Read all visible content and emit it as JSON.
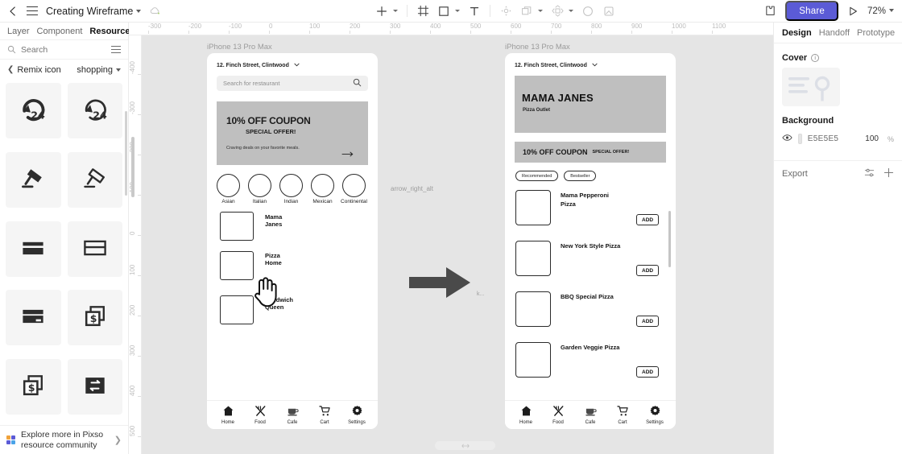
{
  "topbar": {
    "back_icon": "chevron-left-icon",
    "menu_icon": "hamburger-menu-icon",
    "title": "Creating Wireframe",
    "cloud_icon": "cloud-sync-icon",
    "tools": [
      {
        "name": "add-tool",
        "icon": "plus-icon",
        "caret": true
      },
      {
        "name": "frame-tool",
        "icon": "frame-icon",
        "caret": false
      },
      {
        "name": "shape-tool",
        "icon": "square-icon",
        "caret": true
      },
      {
        "name": "text-tool",
        "icon": "text-T-icon",
        "caret": false
      },
      {
        "name": "move-tool",
        "icon": "move-target-icon",
        "caret": false
      },
      {
        "name": "duplicate-tool",
        "icon": "copy-icon",
        "caret": true
      },
      {
        "name": "component-tool",
        "icon": "component-icon",
        "caret": true
      },
      {
        "name": "ellipse-tool",
        "icon": "circle-icon",
        "caret": false
      },
      {
        "name": "image-tool",
        "icon": "image-placeholder-icon",
        "caret": false
      }
    ],
    "plugin_icon": "plugin-puzzle-icon",
    "share_label": "Share",
    "present_icon": "play-triangle-icon",
    "zoom_level": "72%"
  },
  "left_panel": {
    "tabs": [
      {
        "label": "Layer",
        "active": false
      },
      {
        "label": "Component",
        "active": false
      },
      {
        "label": "Resource",
        "active": true
      }
    ],
    "search": {
      "icon": "search-icon",
      "placeholder": "Search",
      "list_icon": "list-view-icon"
    },
    "breadcrumb": {
      "back_icon": "chevron-left-icon",
      "label": "Remix icon",
      "category": "shopping",
      "category_caret": "chevron-down-icon"
    },
    "icons": [
      {
        "name": "time-24-hours-fill-icon"
      },
      {
        "name": "time-24-hours-line-icon"
      },
      {
        "name": "auction-fill-icon"
      },
      {
        "name": "auction-line-icon"
      },
      {
        "name": "bank-card-fill-icon"
      },
      {
        "name": "bank-card-line-icon"
      },
      {
        "name": "bank-card-2-fill-icon"
      },
      {
        "name": "money-dollar-box-fill-icon"
      },
      {
        "name": "money-dollar-box-line-icon"
      },
      {
        "name": "exchange-box-fill-icon"
      }
    ],
    "footer": {
      "icon": "pixso-grid-icon",
      "text": "Explore more in Pixso resource community",
      "arrow": "chevron-right-icon"
    }
  },
  "rulers": {
    "horizontal": [
      "-300",
      "-200",
      "-100",
      "0",
      "100",
      "200",
      "300",
      "400",
      "500",
      "600",
      "700",
      "800",
      "900",
      "1000",
      "1100"
    ],
    "vertical": [
      "-400",
      "-300",
      "-200",
      "-100",
      "0",
      "100",
      "200",
      "300",
      "400",
      "500"
    ]
  },
  "canvas": {
    "background_color": "#e5e5e5",
    "connector": {
      "label": "arrow_right_alt",
      "icon": "arrow-right-alt-icon",
      "small_label": "k..."
    },
    "cursor": "pointing-hand-cursor",
    "frame1": {
      "label": "iPhone 13 Pro Max",
      "address": "12. Finch Street, Clintwood",
      "address_caret": "chevron-down-icon",
      "search_placeholder": "Search for restaurant",
      "search_icon": "search-icon",
      "coupon": {
        "title": "10% OFF COUPON",
        "subtitle": "SPECIAL OFFER!",
        "body": "Craving deals on your favorite meals.",
        "arrow": "arrow-right-icon"
      },
      "categories": [
        "Asian",
        "Italian",
        "Indian",
        "Mexican",
        "Continental"
      ],
      "restaurants": [
        "Mama Janes",
        "Pizza Home",
        "Sandwich Queen"
      ],
      "tabbar": [
        {
          "label": "Home",
          "icon": "home-icon"
        },
        {
          "label": "Food",
          "icon": "fork-knife-icon"
        },
        {
          "label": "Cafe",
          "icon": "coffee-cup-icon"
        },
        {
          "label": "Cart",
          "icon": "shopping-cart-icon"
        },
        {
          "label": "Settings",
          "icon": "gear-icon"
        }
      ]
    },
    "frame2": {
      "label": "iPhone 13 Pro Max",
      "address": "12. Finch Street, Clintwood",
      "address_caret": "chevron-down-icon",
      "hero_title": "MAMA JANES",
      "hero_subtitle": "Pizza Outlet",
      "coupon_title": "10% OFF COUPON",
      "coupon_sub": "SPECIAL OFFER!",
      "chips": [
        "Recommended",
        "Bestseller"
      ],
      "items": [
        {
          "name": "Mama Pepperoni Pizza",
          "add_label": "ADD"
        },
        {
          "name": "New York Style Pizza",
          "add_label": "ADD"
        },
        {
          "name": "BBQ Special Pizza",
          "add_label": "ADD"
        },
        {
          "name": "Garden Veggie Pizza",
          "add_label": "ADD"
        }
      ],
      "tabbar": [
        {
          "label": "Home",
          "icon": "home-icon"
        },
        {
          "label": "Food",
          "icon": "fork-knife-icon"
        },
        {
          "label": "Cafe",
          "icon": "coffee-cup-icon"
        },
        {
          "label": "Cart",
          "icon": "shopping-cart-icon"
        },
        {
          "label": "Settings",
          "icon": "gear-icon"
        }
      ]
    }
  },
  "right_panel": {
    "tabs": [
      {
        "label": "Design",
        "active": true
      },
      {
        "label": "Handoff",
        "active": false
      },
      {
        "label": "Prototype",
        "active": false
      }
    ],
    "cover": {
      "label": "Cover",
      "info_icon": "info-icon"
    },
    "background": {
      "label": "Background",
      "visibility_icon": "eye-icon",
      "color": "E5E5E5",
      "opacity": "100",
      "opacity_unit": "%"
    },
    "export": {
      "label": "Export",
      "settings_icon": "sliders-icon",
      "add_icon": "plus-icon"
    }
  }
}
